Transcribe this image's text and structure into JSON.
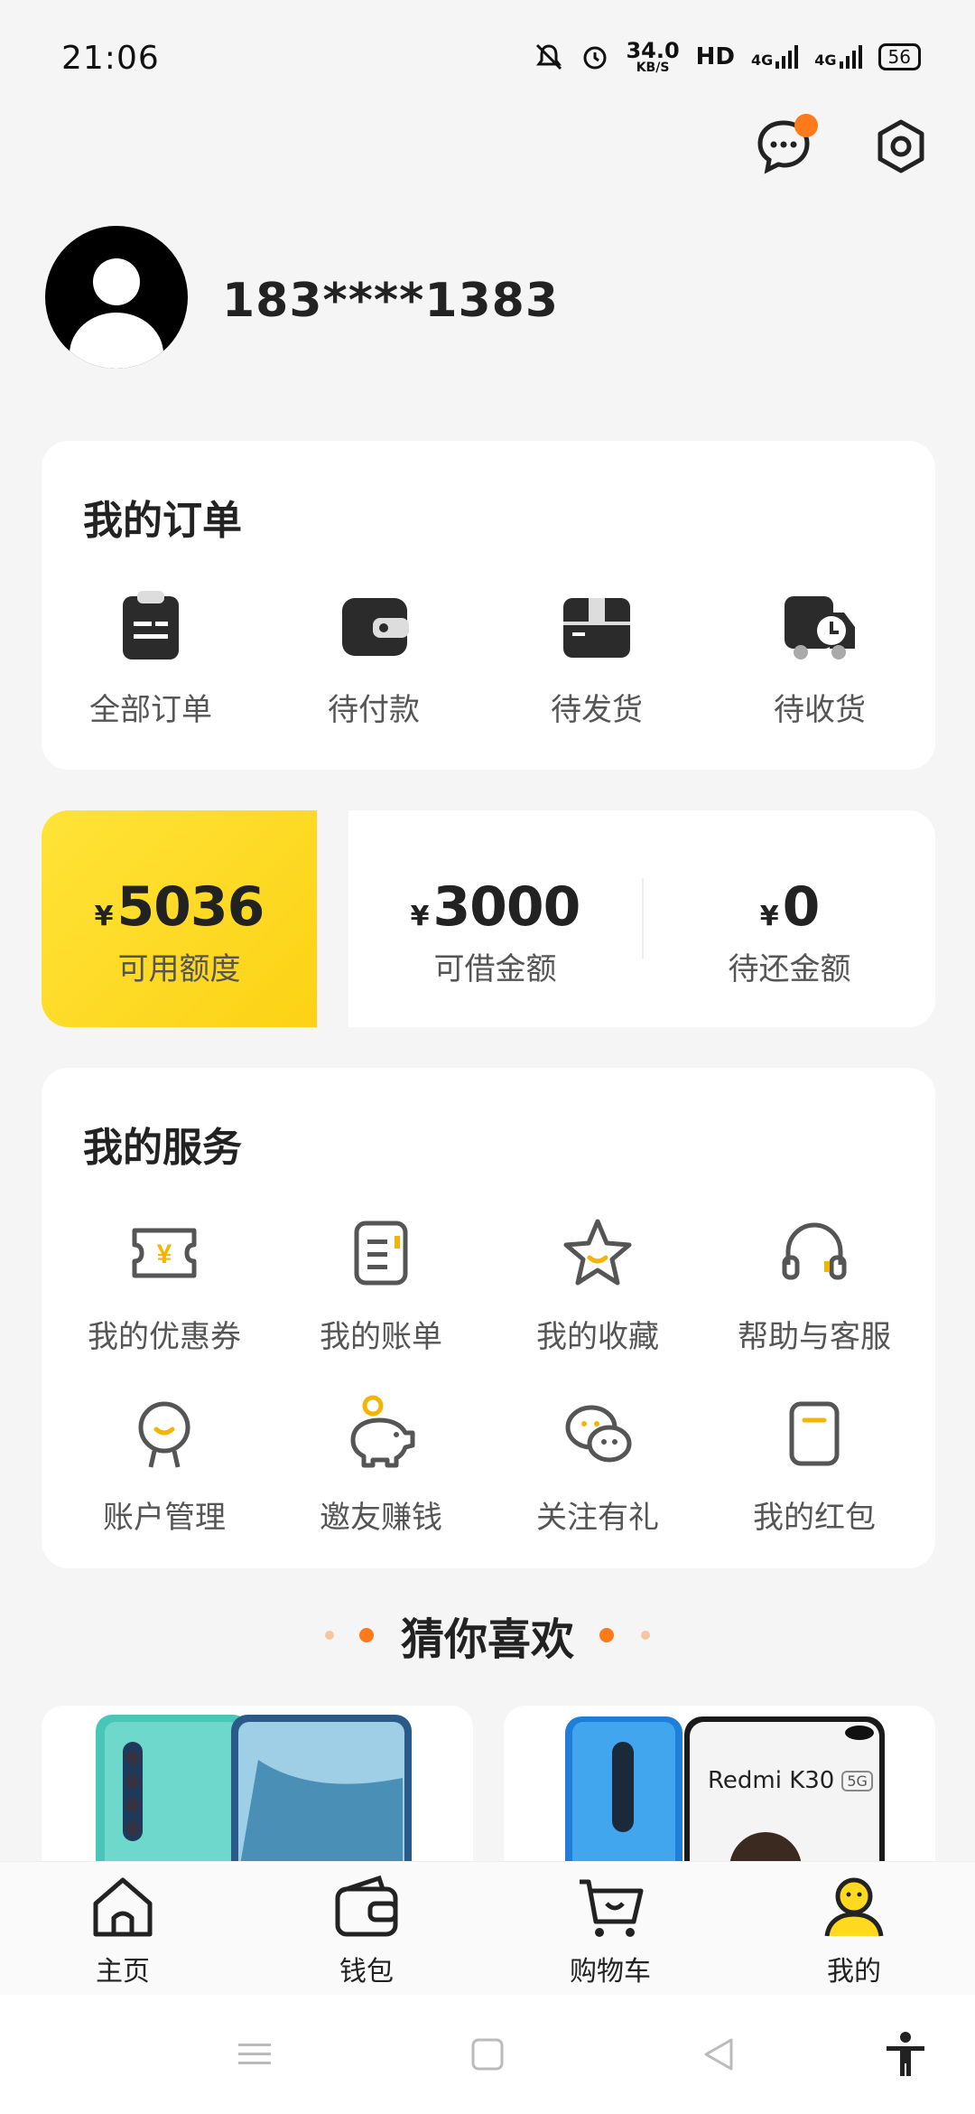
{
  "status_bar": {
    "time": "21:06",
    "speed_value": "34.0",
    "speed_unit": "KB/S",
    "hd": "HD",
    "net1": "4G",
    "net2": "4G",
    "battery": "56"
  },
  "profile": {
    "phone": "183****1383"
  },
  "orders": {
    "title": "我的订单",
    "items": [
      {
        "label": "全部订单",
        "icon": "clipboard-icon"
      },
      {
        "label": "待付款",
        "icon": "wallet-icon"
      },
      {
        "label": "待发货",
        "icon": "box-icon"
      },
      {
        "label": "待收货",
        "icon": "truck-icon"
      }
    ]
  },
  "credit": {
    "currency": "¥",
    "available": {
      "amount": "5036",
      "label": "可用额度"
    },
    "borrowable": {
      "amount": "3000",
      "label": "可借金额"
    },
    "repay": {
      "amount": "0",
      "label": "待还金额"
    }
  },
  "services": {
    "title": "我的服务",
    "items": [
      {
        "label": "我的优惠券",
        "icon": "coupon-icon"
      },
      {
        "label": "我的账单",
        "icon": "bill-icon"
      },
      {
        "label": "我的收藏",
        "icon": "star-icon"
      },
      {
        "label": "帮助与客服",
        "icon": "headset-icon"
      },
      {
        "label": "账户管理",
        "icon": "account-icon"
      },
      {
        "label": "邀友赚钱",
        "icon": "piggy-bank-icon"
      },
      {
        "label": "关注有礼",
        "icon": "wechat-icon"
      },
      {
        "label": "我的红包",
        "icon": "red-packet-icon"
      }
    ]
  },
  "guess": {
    "title": "猜你喜欢"
  },
  "products": [
    {
      "brand_text": ""
    },
    {
      "brand_text": "Redmi K30",
      "badge": "5G"
    }
  ],
  "tabs": [
    {
      "label": "主页",
      "icon": "home-icon"
    },
    {
      "label": "钱包",
      "icon": "wallet-icon"
    },
    {
      "label": "购物车",
      "icon": "cart-icon"
    },
    {
      "label": "我的",
      "icon": "profile-icon"
    }
  ],
  "colors": {
    "accent": "#FFD91F",
    "dot": "#FF7A1A"
  }
}
